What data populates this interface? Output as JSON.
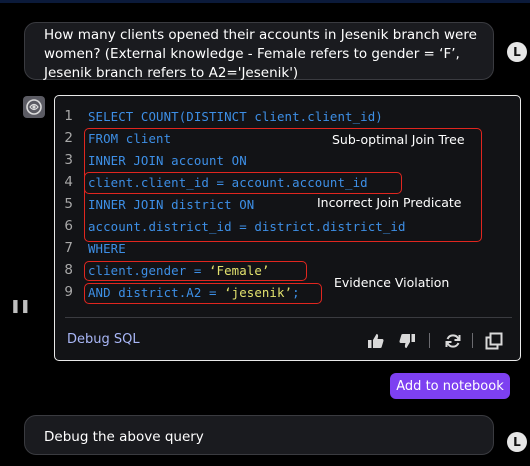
{
  "question": {
    "lines": [
      "How many clients opened their accounts in Jesenik branch were",
      "women? (External knowledge - Female refers to gender = ‘F’,",
      "Jesenik branch refers to A2='Jesenik')"
    ],
    "avatar_letter": "L"
  },
  "sql": {
    "line_numbers": [
      "1",
      "2",
      "3",
      "4",
      "5",
      "6",
      "7",
      "8",
      "9"
    ],
    "lines": [
      "SELECT COUNT(DISTINCT client.client_id)",
      "FROM client",
      "INNER JOIN account ON",
      "client.client_id = account.account_id",
      "INNER JOIN district ON",
      "account.district_id = district.district_id",
      "WHERE",
      {
        "pre": "client.gender = ",
        "str": "‘Female’",
        "post": ""
      },
      {
        "pre": "AND district.A2 = ",
        "str": "‘jesenik’",
        "post": ";"
      }
    ]
  },
  "annotations": {
    "join_tree": "Sub-optimal Join Tree",
    "join_predicate": "Incorrect Join Predicate",
    "evidence": "Evidence Violation",
    "highlight_color": "#e0261f"
  },
  "actions": {
    "debug_label": "Debug SQL",
    "icons": [
      "thumbs-up-icon",
      "thumbs-down-icon",
      "regenerate-icon",
      "copy-icon"
    ],
    "add_to_notebook": "Add to notebook"
  },
  "followup": {
    "text": "Debug the above query",
    "avatar_letter": "L"
  },
  "colors": {
    "sql_keyword": "#3d8fe6",
    "sql_string": "#e2e26e",
    "button_accent": "#7d40f1",
    "link": "#a9b7f7"
  }
}
